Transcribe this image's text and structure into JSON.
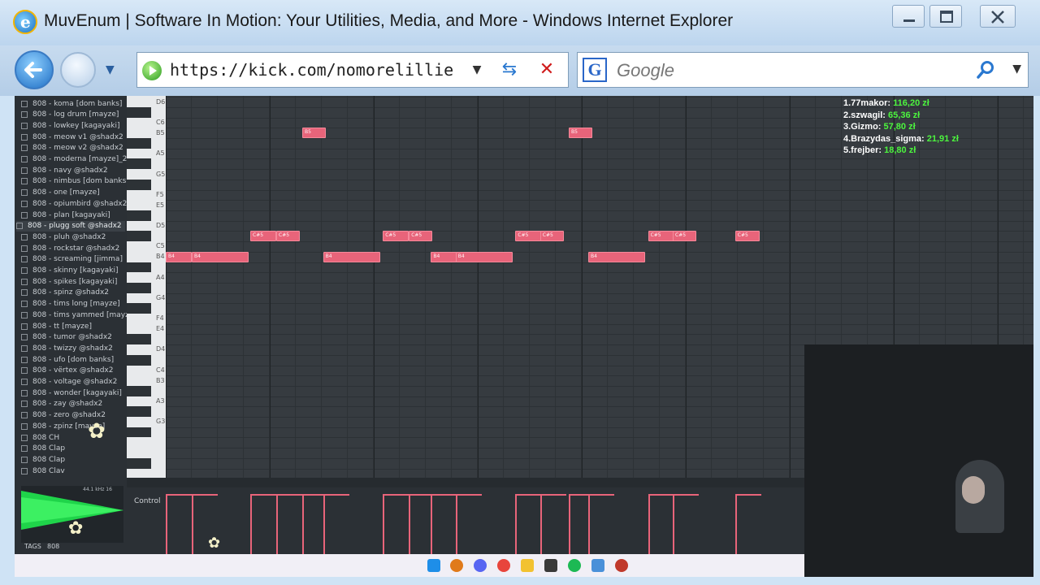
{
  "window": {
    "title": "MuvEnum | Software In Motion: Your Utilities, Media, and More - Windows Internet Explorer"
  },
  "nav": {
    "address": "https://kick.com/nomorelillie",
    "search_placeholder": "Google",
    "search_logo": "G"
  },
  "browser_panel": {
    "items": [
      "808 - koma [dom banks]",
      "808 - log drum [mayze]",
      "808 - lowkey [kagayaki]",
      "808 - meow v1 @shadx2",
      "808 - meow v2 @shadx2",
      "808 - moderna [mayze]_2",
      "808 - navy @shadx2",
      "808 - nimbus [dom banks]",
      "808 - one [mayze]",
      "808 - opiumbird @shadx2",
      "808 - plan [kagayaki]",
      "808 - plugg soft @shadx2",
      "808 - pluh @shadx2",
      "808 - rockstar @shadx2",
      "808 - screaming [jimma]",
      "808 - skinny [kagayaki]",
      "808 - spikes [kagayaki]",
      "808 - spinz @shadx2",
      "808 - tims long [mayze]",
      "808 - tims yammed [mayze]",
      "808 - tt [mayze]",
      "808 - tumor @shadx2",
      "808 - twizzy @shadx2",
      "808 - ufo [dom banks]",
      "808 - vërtex @shadx2",
      "808 - voltage @shadx2",
      "808 - wonder [kagayaki]",
      "808 - zay @shadx2",
      "808 - zero @shadx2",
      "808 - zpinz [mayze]",
      "808 CH",
      "808 Clap",
      "808 Clap",
      "808 Clav"
    ],
    "selected_index": 11,
    "sample_rate": "44.1 kHz 16",
    "tags_label": "TAGS",
    "tags_value": "808"
  },
  "piano_roll": {
    "key_labels": [
      "D6",
      "C6",
      "B5",
      "A5",
      "G5",
      "F5",
      "E5",
      "D5",
      "C5",
      "B4",
      "A4",
      "G4",
      "F4",
      "E4",
      "D4",
      "C4",
      "B3",
      "A3",
      "G3"
    ],
    "notes": [
      {
        "label": "B5",
        "pitch": "B5",
        "start_beat": 5.25,
        "length_beats": 0.9
      },
      {
        "label": "B5",
        "pitch": "B5",
        "start_beat": 15.5,
        "length_beats": 0.9
      },
      {
        "label": "C#5",
        "pitch": "C#5",
        "start_beat": 3.25,
        "length_beats": 1
      },
      {
        "label": "C#5",
        "pitch": "C#5",
        "start_beat": 4.25,
        "length_beats": 0.9
      },
      {
        "label": "C#5",
        "pitch": "C#5",
        "start_beat": 8.35,
        "length_beats": 1
      },
      {
        "label": "C#5",
        "pitch": "C#5",
        "start_beat": 9.35,
        "length_beats": 0.9
      },
      {
        "label": "C#5",
        "pitch": "C#5",
        "start_beat": 13.45,
        "length_beats": 1
      },
      {
        "label": "C#5",
        "pitch": "C#5",
        "start_beat": 14.4,
        "length_beats": 0.9
      },
      {
        "label": "C#5",
        "pitch": "C#5",
        "start_beat": 18.55,
        "length_beats": 1
      },
      {
        "label": "C#5",
        "pitch": "C#5",
        "start_beat": 19.5,
        "length_beats": 0.9
      },
      {
        "label": "C#5",
        "pitch": "C#5",
        "start_beat": 21.9,
        "length_beats": 0.95
      },
      {
        "label": "B4",
        "pitch": "B4",
        "start_beat": 0,
        "length_beats": 1
      },
      {
        "label": "B4",
        "pitch": "B4",
        "start_beat": 1,
        "length_beats": 2.2
      },
      {
        "label": "B4",
        "pitch": "B4",
        "start_beat": 6.05,
        "length_beats": 2.2
      },
      {
        "label": "B4",
        "pitch": "B4",
        "start_beat": 10.2,
        "length_beats": 1
      },
      {
        "label": "B4",
        "pitch": "B4",
        "start_beat": 11.15,
        "length_beats": 2.2
      },
      {
        "label": "B4",
        "pitch": "B4",
        "start_beat": 16.25,
        "length_beats": 2.2
      }
    ],
    "control_label": "Control"
  },
  "leaderboard": [
    {
      "name": "1.77makor:",
      "amount": "116,20 zł"
    },
    {
      "name": "2.szwagil:",
      "amount": "65,36 zł"
    },
    {
      "name": "3.Gizmo:",
      "amount": "57,80 zł"
    },
    {
      "name": "4.Brazydas_sigma:",
      "amount": "21,91 zł"
    },
    {
      "name": "5.frejber:",
      "amount": "18,80 zł"
    }
  ],
  "colors": {
    "note": "#e8647a",
    "leaderboard_amount": "#4cf53e",
    "grid_bg": "#363b40",
    "titlebar": "#c7dbef"
  },
  "icons": {
    "ie": "internet-explorer-icon",
    "back": "back-arrow-icon",
    "forward": "forward-arrow-icon",
    "refresh": "refresh-icon",
    "stop": "stop-x-icon",
    "search": "search-icon"
  }
}
